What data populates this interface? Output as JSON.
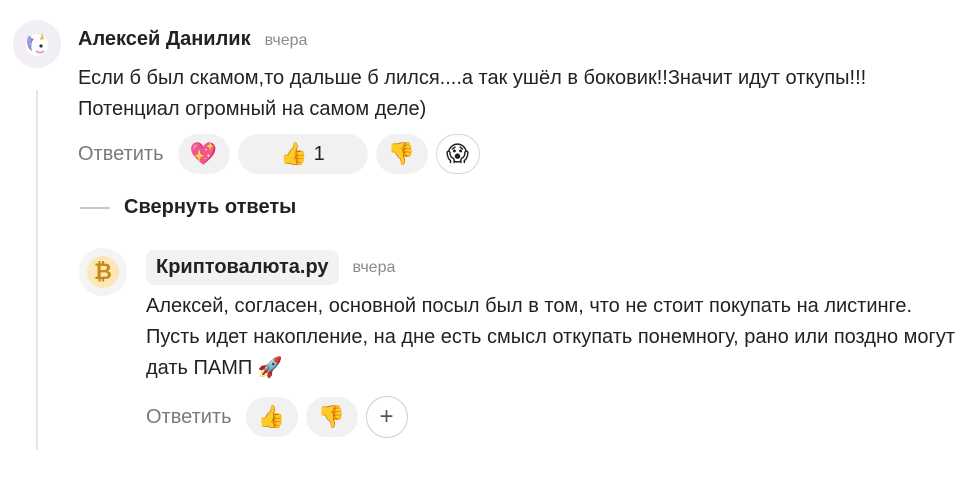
{
  "comment": {
    "author": "Алексей Данилик",
    "time": "вчера",
    "avatar_icon": "unicorn-icon",
    "text": "Если б был скамом,то дальше б лился....а так ушёл в боковик!!Значит идут откупы!!!Потенциал огромный на самом деле)",
    "reply_label": "Ответить",
    "reactions": [
      {
        "icon": "heart-hands-icon",
        "glyph": "💖",
        "count": ""
      },
      {
        "icon": "thumbs-up-icon",
        "glyph": "👍",
        "count": "1"
      },
      {
        "icon": "thumbs-down-icon",
        "glyph": "👎",
        "count": ""
      },
      {
        "icon": "scream-face-icon",
        "glyph": "😱",
        "count": ""
      }
    ]
  },
  "collapse": {
    "label": "Свернуть ответы"
  },
  "reply": {
    "author": "Криптовалюта.ру",
    "time": "вчера",
    "avatar_icon": "bitcoin-icon",
    "text": "Алексей, согласен, основной посыл был в том, что не стоит покупать на листинге. Пусть идет накопление, на дне есть смысл откупать понемногу, рано или поздно могут дать ПАМП 🚀",
    "reply_label": "Ответить",
    "reactions": [
      {
        "icon": "thumbs-up-icon",
        "glyph": "👍"
      },
      {
        "icon": "thumbs-down-icon",
        "glyph": "👎"
      }
    ],
    "add_reaction": "+"
  }
}
